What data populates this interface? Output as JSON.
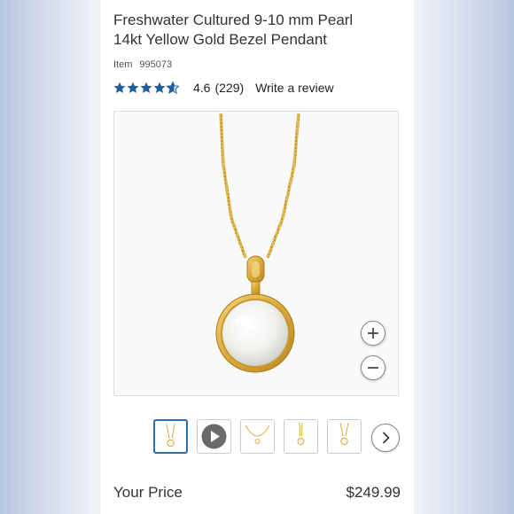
{
  "product": {
    "title_line1": "Freshwater Cultured 9-10 mm Pearl",
    "title_line2": "14kt Yellow Gold Bezel Pendant",
    "item_label": "Item",
    "item_number": "995073",
    "rating": {
      "stars": 4.6,
      "value": "4.6",
      "count": "(229)",
      "write_review": "Write a review"
    }
  },
  "gallery": {
    "zoom_in": "zoom-in-icon",
    "zoom_out": "zoom-out-icon",
    "thumbnails": [
      {
        "kind": "pendant-front",
        "selected": true
      },
      {
        "kind": "video"
      },
      {
        "kind": "pendant-on-chain"
      },
      {
        "kind": "pendant-side"
      },
      {
        "kind": "pendant-back"
      }
    ],
    "next_icon": "chevron-right-icon"
  },
  "pricing": {
    "label": "Your Price",
    "value": "$249.99"
  },
  "colors": {
    "star": "#1f5e9e",
    "gold": "#d9a93a",
    "selected_border": "#2a6db0"
  }
}
